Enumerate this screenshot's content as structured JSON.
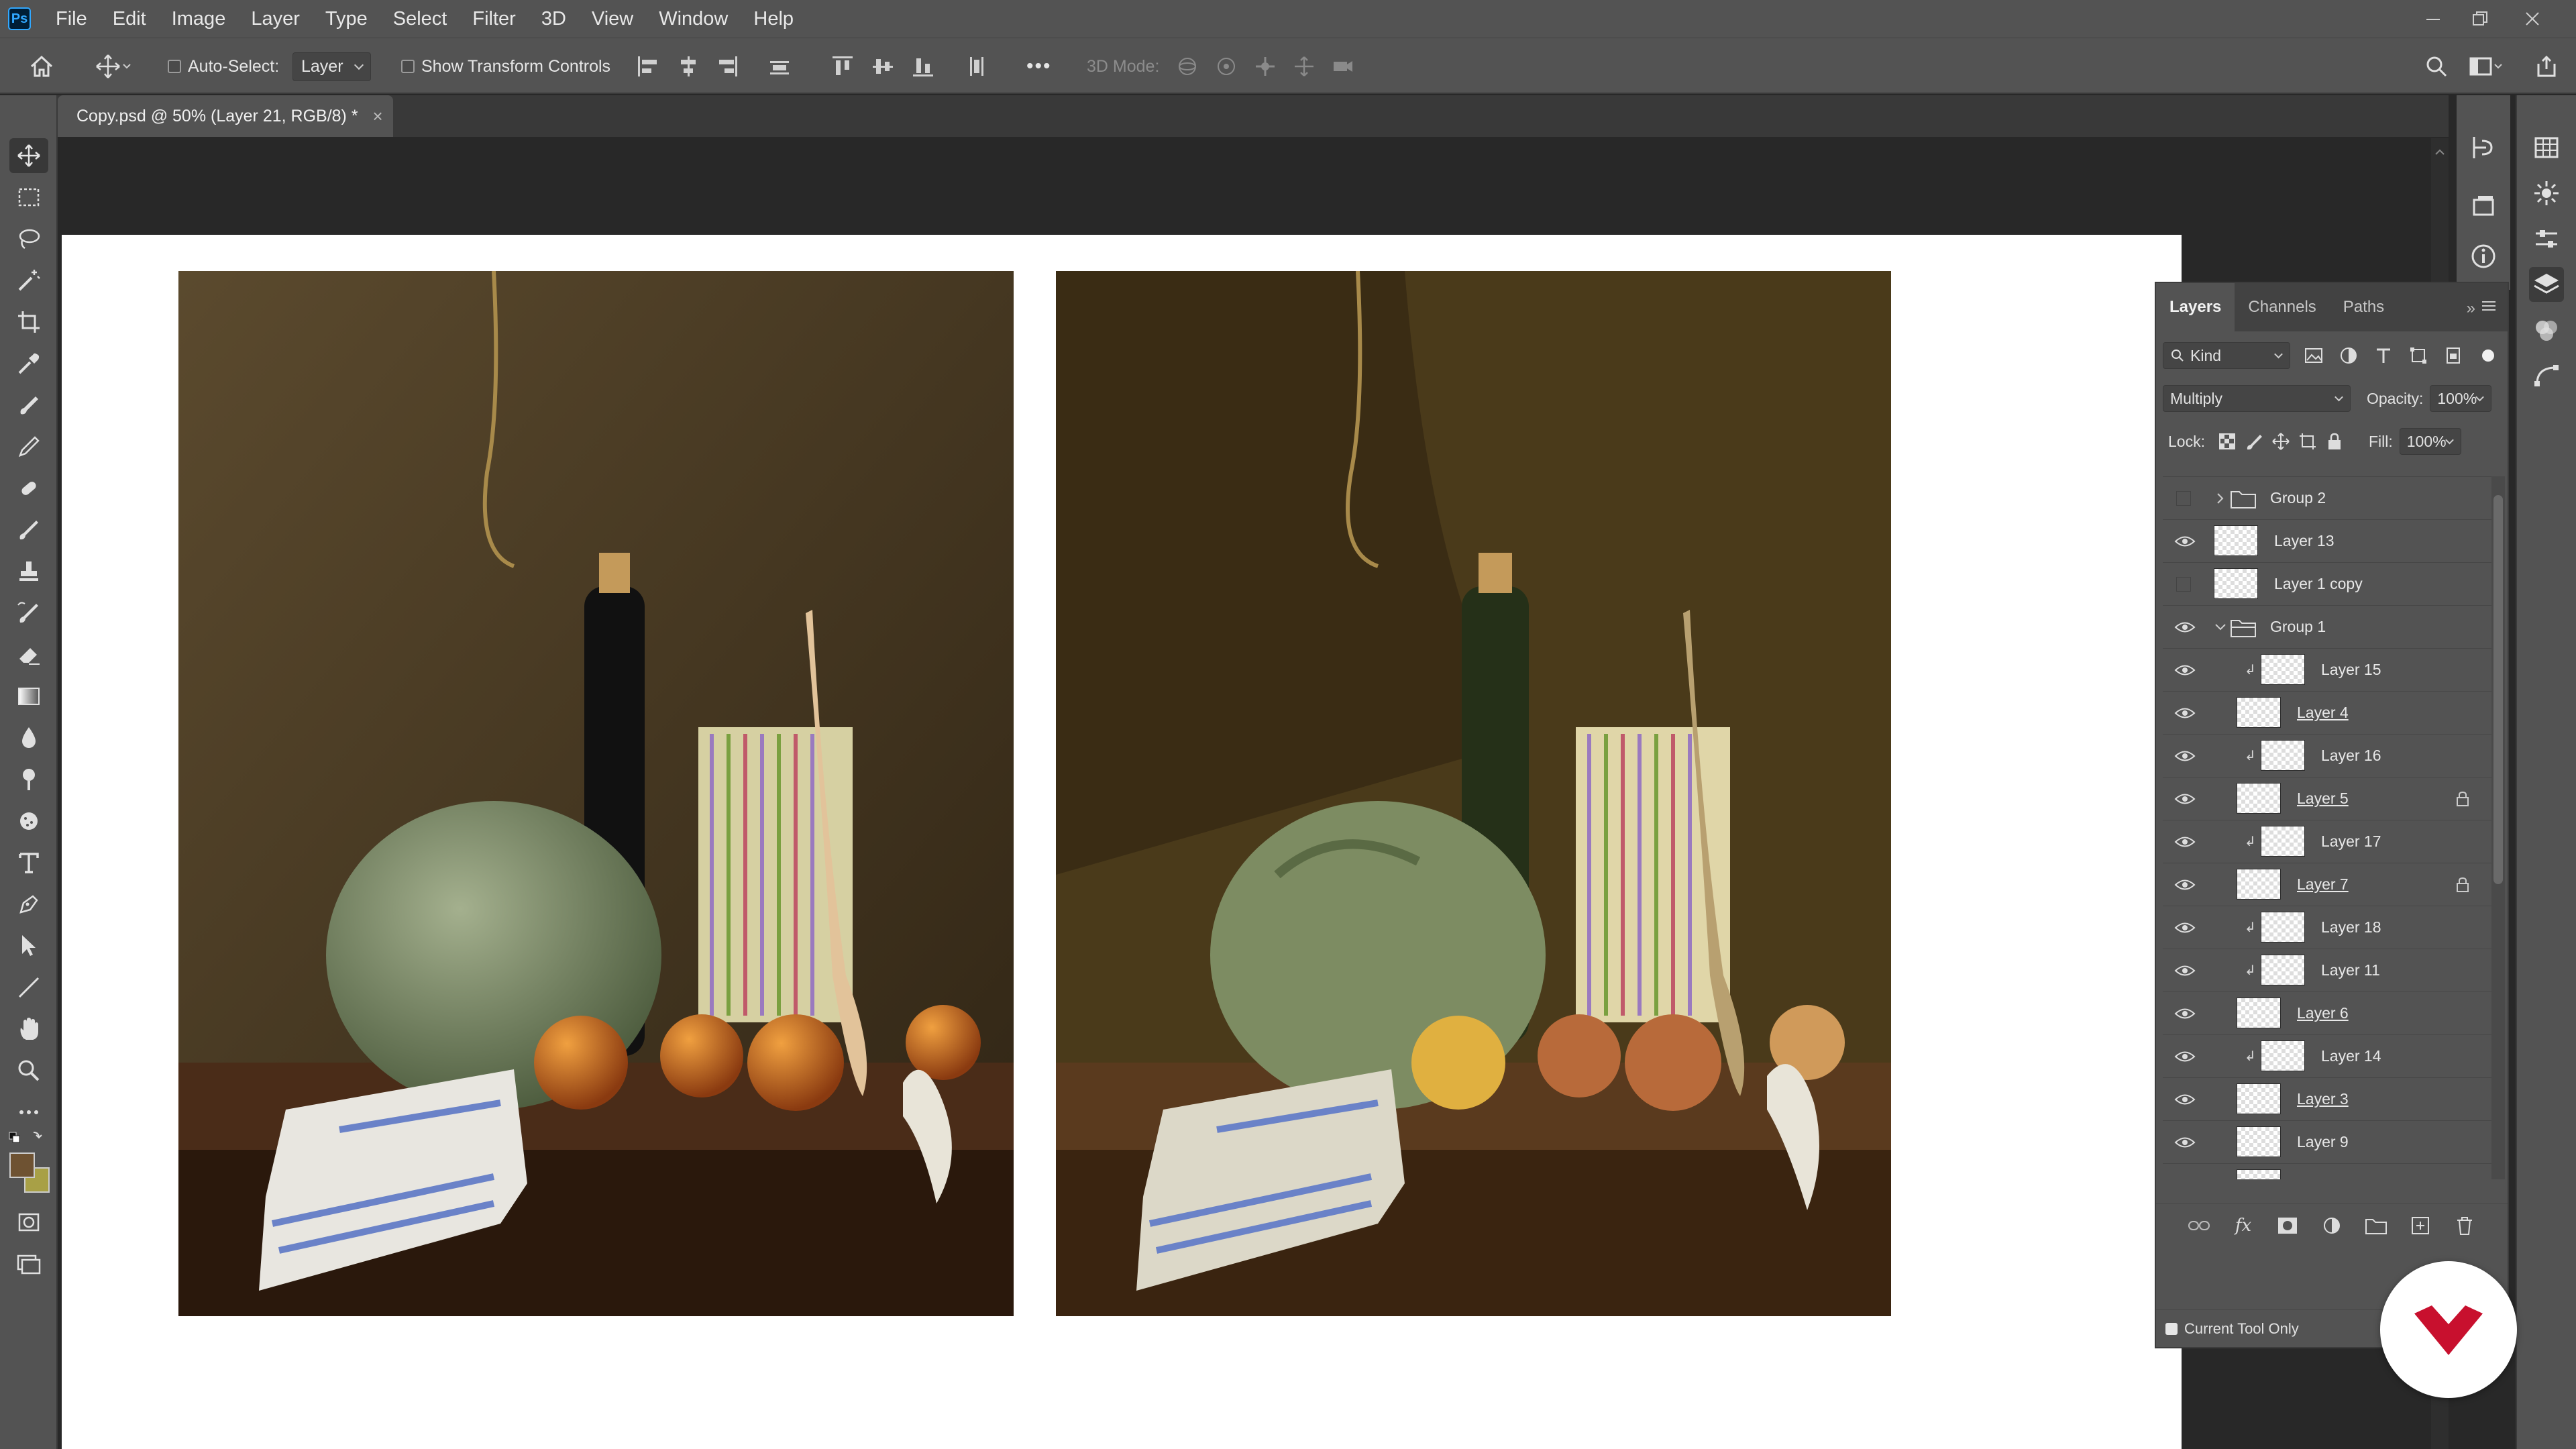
{
  "app": {
    "logo_text": "Ps"
  },
  "menu": [
    "File",
    "Edit",
    "Image",
    "Layer",
    "Type",
    "Select",
    "Filter",
    "3D",
    "View",
    "Window",
    "Help"
  ],
  "options_bar": {
    "auto_select_label": "Auto-Select:",
    "auto_select_checked": false,
    "auto_select_target": "Layer",
    "show_transform_label": "Show Transform Controls",
    "show_transform_checked": false,
    "mode_3d_label": "3D Mode:",
    "more_glyph": "•••"
  },
  "document": {
    "tab_title": "Copy.psd @ 50% (Layer 21, RGB/8) *",
    "close_glyph": "×",
    "canvas_bg": "#ffffff"
  },
  "toolbox": {
    "tools": [
      "move",
      "rectangular-marquee",
      "lasso",
      "magic-wand",
      "crop",
      "eyedropper",
      "spot-healing-brush",
      "brush",
      "pencil",
      "clone-stamp",
      "history-brush",
      "eraser",
      "gradient",
      "blur",
      "dodge",
      "sponge",
      "type",
      "pen",
      "path-selection",
      "line",
      "hand",
      "zoom",
      "more"
    ],
    "selected": "move",
    "foreground_color": "#6e5232",
    "background_color": "#a8a046"
  },
  "layers_panel": {
    "tabs": [
      "Layers",
      "Channels",
      "Paths"
    ],
    "active_tab": "Layers",
    "filter_label": "Kind",
    "blend_mode": "Multiply",
    "opacity_label": "Opacity:",
    "opacity_value": "100%",
    "lock_label": "Lock:",
    "fill_label": "Fill:",
    "fill_value": "100%",
    "layers": [
      {
        "name": "Group 2",
        "type": "group",
        "visible": false,
        "expanded": false,
        "indent": 0
      },
      {
        "name": "Layer 13",
        "type": "layer",
        "visible": true,
        "indent": 0
      },
      {
        "name": "Layer 1 copy",
        "type": "layer",
        "visible": false,
        "indent": 0
      },
      {
        "name": "Group 1",
        "type": "group",
        "visible": true,
        "expanded": true,
        "indent": 0
      },
      {
        "name": "Layer 15",
        "type": "layer",
        "visible": true,
        "indent": 1,
        "clipped": true
      },
      {
        "name": "Layer 4",
        "type": "layer",
        "visible": true,
        "indent": 1,
        "underlined": true
      },
      {
        "name": "Layer 16",
        "type": "layer",
        "visible": true,
        "indent": 1,
        "clipped": true
      },
      {
        "name": "Layer 5",
        "type": "layer",
        "visible": true,
        "indent": 1,
        "underlined": true,
        "locked": true
      },
      {
        "name": "Layer 17",
        "type": "layer",
        "visible": true,
        "indent": 1,
        "clipped": true
      },
      {
        "name": "Layer 7",
        "type": "layer",
        "visible": true,
        "indent": 1,
        "underlined": true,
        "locked": true
      },
      {
        "name": "Layer 18",
        "type": "layer",
        "visible": true,
        "indent": 1,
        "clipped": true
      },
      {
        "name": "Layer 11",
        "type": "layer",
        "visible": true,
        "indent": 1,
        "clipped": true
      },
      {
        "name": "Layer 6",
        "type": "layer",
        "visible": true,
        "indent": 1,
        "underlined": true
      },
      {
        "name": "Layer 14",
        "type": "layer",
        "visible": true,
        "indent": 1,
        "clipped": true
      },
      {
        "name": "Layer 3",
        "type": "layer",
        "visible": true,
        "indent": 1,
        "underlined": true
      },
      {
        "name": "Layer 9",
        "type": "layer",
        "visible": true,
        "indent": 1
      }
    ],
    "current_tool_only_label": "Current Tool Only",
    "current_tool_only_checked": true
  },
  "colors": {
    "brand_red": "#c8102e",
    "ps_blue": "#31a8ff"
  }
}
